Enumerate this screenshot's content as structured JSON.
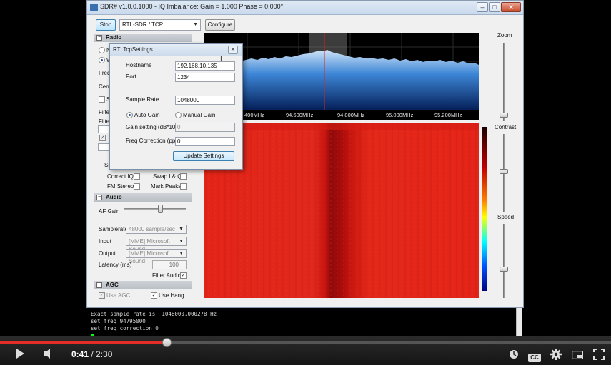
{
  "window": {
    "title": "SDR# v1.0.0.1000 - IQ Imbalance: Gain = 1.000 Phase = 0.000°",
    "controls": [
      "–",
      "□",
      "✕"
    ]
  },
  "toolbar": {
    "stop_label": "Stop",
    "source_value": "RTL-SDR / TCP",
    "configure_label": "Configure"
  },
  "radio": {
    "header": "Radio",
    "partial_labels": [
      "N",
      "W",
      "Freq",
      "Cent",
      "S",
      "Filter",
      "Filter",
      "Sn"
    ],
    "correct_iq": "Correct IQ",
    "swap_iq": "Swap I & Q",
    "fm_stereo": "FM Stereo",
    "mark_peaks": "Mark Peaks"
  },
  "audio": {
    "header": "Audio",
    "af_gain_label": "AF Gain",
    "af_gain_level": 0.65,
    "samplerate_label": "Samplerate",
    "samplerate_value": "48000 sample/sec",
    "input_label": "Input",
    "input_value": "[MME] Microsoft Sound",
    "output_label": "Output",
    "output_value": "[MME] Microsoft Sound",
    "latency_label": "Latency (ms)",
    "latency_value": "100",
    "filter_audio_label": "Filter Audio"
  },
  "agc": {
    "header": "AGC",
    "use_agc_label": "Use AGC",
    "use_hang_label": "Use Hang"
  },
  "spectrum": {
    "freq_labels": [
      "400MHz",
      "94.600MHz",
      "94.800MHz",
      "95.000MHz",
      "95.200MHz"
    ]
  },
  "right_controls": {
    "zoom_label": "Zoom",
    "contrast_label": "Contrast",
    "speed_label": "Speed"
  },
  "console": {
    "lines": [
      "Exact sample rate is: 1048000.000278 Hz",
      "set freq 94795000",
      "set freq correction 0"
    ]
  },
  "dialog": {
    "title": "RTLTcpSettings",
    "close_glyph": "✕",
    "hostname_label": "Hostname",
    "hostname_value": "192.168.10.135",
    "port_label": "Port",
    "port_value": "1234",
    "sample_rate_label": "Sample Rate",
    "sample_rate_value": "1048000",
    "auto_gain_label": "Auto Gain",
    "manual_gain_label": "Manual Gain",
    "gain_setting_label": "Gain setting (dB*10)",
    "gain_setting_value": "0",
    "freq_correction_label": "Freq Correction (ppm)",
    "freq_correction_value": "0",
    "update_label": "Update Settings"
  },
  "player": {
    "current_time": "0:41",
    "duration": "/ 2:30",
    "progress": 0.273,
    "cc_label": "CC"
  }
}
